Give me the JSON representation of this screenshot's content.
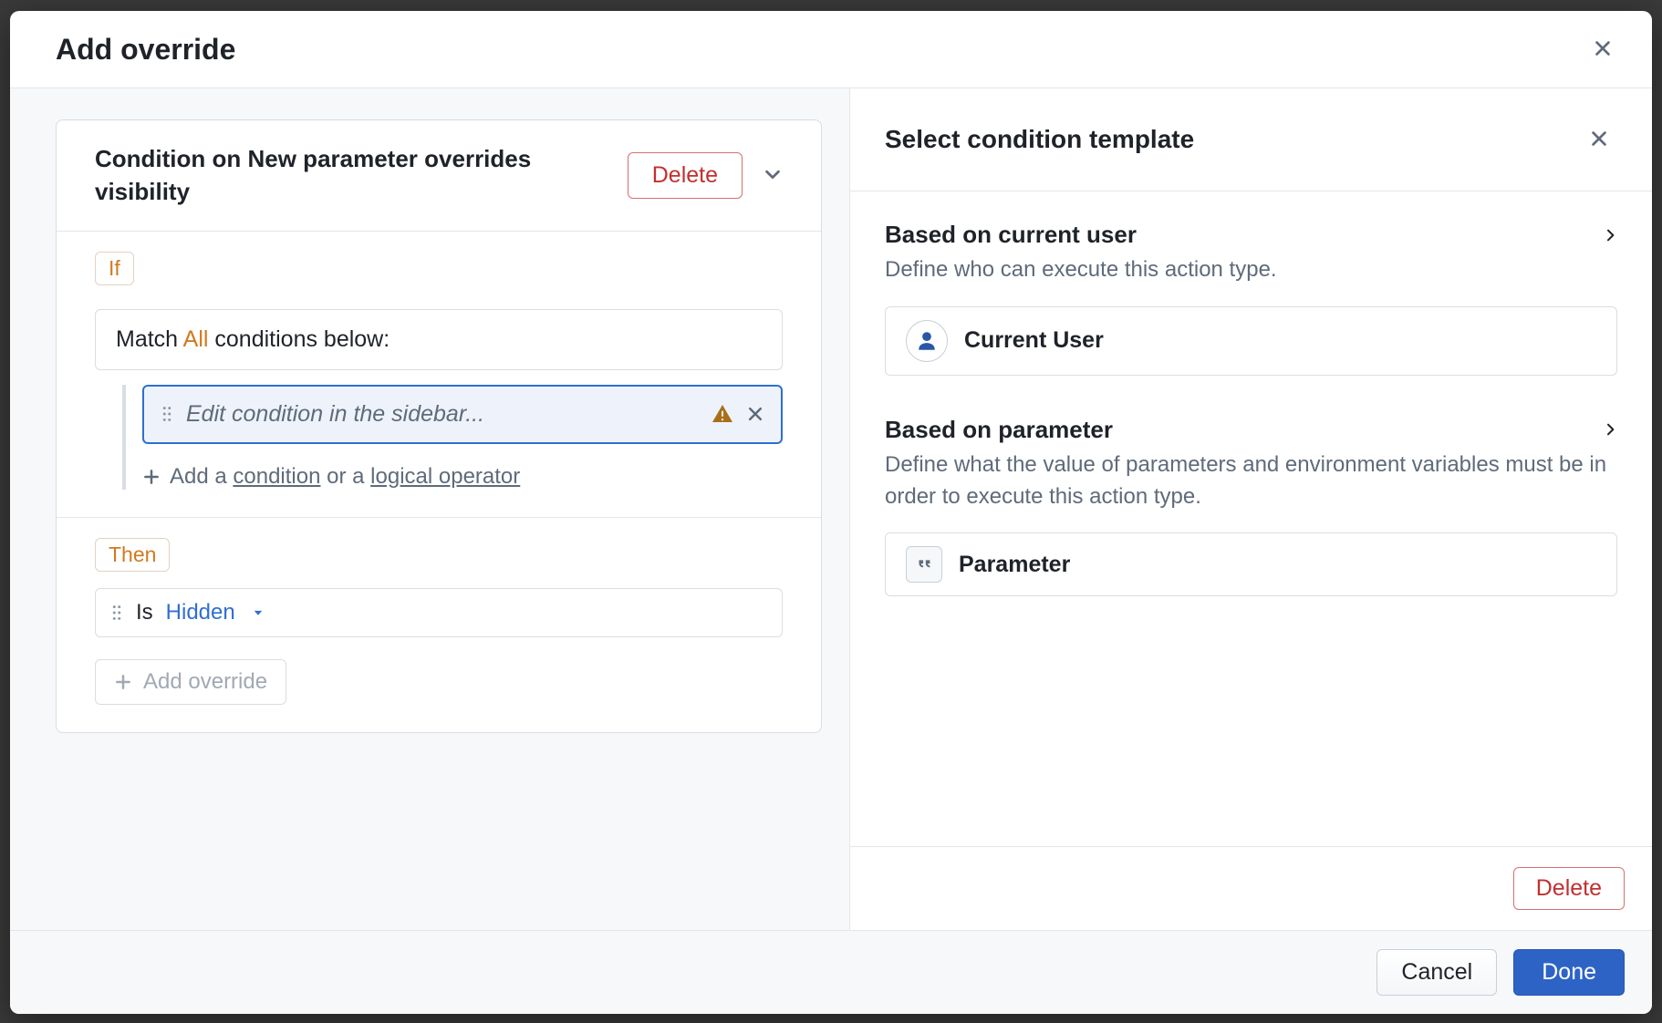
{
  "dialog": {
    "title": "Add override",
    "cancel_label": "Cancel",
    "done_label": "Done"
  },
  "left": {
    "card_title": "Condition on New parameter overrides visibility",
    "delete_label": "Delete",
    "if_label": "If",
    "match_prefix": "Match ",
    "match_all": "All",
    "match_suffix": " conditions below:",
    "condition_placeholder": "Edit condition in the sidebar...",
    "add_cond_prefix": "Add a ",
    "add_cond_condition": "condition",
    "add_cond_middle": " or a ",
    "add_cond_operator": "logical operator",
    "then_label": "Then",
    "is_label": "Is",
    "hidden_value": "Hidden",
    "add_override_label": "Add override"
  },
  "right": {
    "title": "Select condition template",
    "categories": [
      {
        "title": "Based on current user",
        "sub": "Define who can execute this action type.",
        "item_label": "Current User",
        "item_kind": "user"
      },
      {
        "title": "Based on parameter",
        "sub": "Define what the value of parameters and environment variables must be in order to execute this action type.",
        "item_label": "Parameter",
        "item_kind": "param"
      }
    ],
    "delete_label": "Delete"
  }
}
